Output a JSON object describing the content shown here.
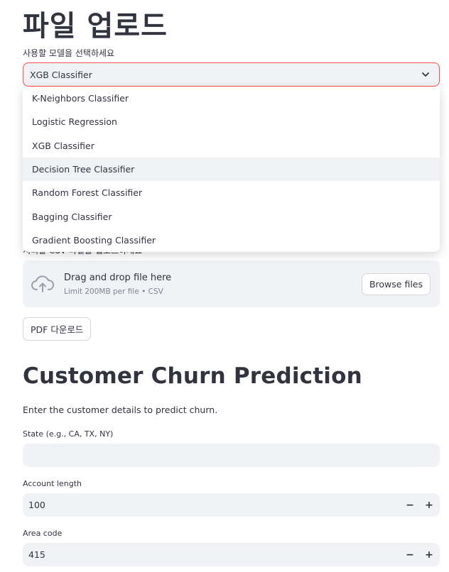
{
  "header": {
    "title": "파일 업로드"
  },
  "model_select": {
    "label": "사용할 모델을 선택하세요",
    "selected": "XGB Classifier",
    "options": [
      "K-Neighbors Classifier",
      "Logistic Regression",
      "XGB Classifier",
      "Decision Tree Classifier",
      "Random Forest Classifier",
      "Bagging Classifier",
      "Gradient Boosting Classifier"
    ],
    "accent_color": "#ff4b4b"
  },
  "uploader": {
    "label": "처리할 CSV 파일을 업로드하세요",
    "drop_title": "Drag and drop file here",
    "limit_text": "Limit 200MB per file • CSV",
    "browse_label": "Browse files",
    "icon": "cloud-upload-icon"
  },
  "pdf_button": {
    "label": "PDF 다운로드"
  },
  "prediction": {
    "title": "Customer Churn Prediction",
    "description": "Enter the customer details to predict churn.",
    "fields": [
      {
        "label": "State (e.g., CA, TX, NY)",
        "value": ""
      },
      {
        "label": "Account length",
        "value": "100",
        "minus": "−",
        "plus": "+"
      },
      {
        "label": "Area code",
        "value": "415",
        "minus": "−",
        "plus": "+"
      }
    ]
  }
}
